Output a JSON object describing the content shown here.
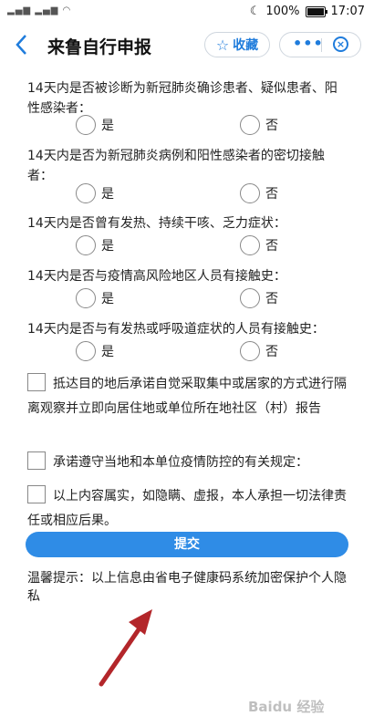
{
  "status_bar": {
    "battery": "100%",
    "time": "17:07"
  },
  "nav": {
    "title": "来鲁自行申报",
    "favorite_label": "收藏"
  },
  "questions": [
    {
      "text": "14天内是否被诊断为新冠肺炎确诊患者、疑似患者、阳性感染者：",
      "yes": "是",
      "no": "否"
    },
    {
      "text": "14天内是否为新冠肺炎病例和阳性感染者的密切接触者：",
      "yes": "是",
      "no": "否"
    },
    {
      "text": "14天内是否曾有发热、持续干咳、乏力症状：",
      "yes": "是",
      "no": "否"
    },
    {
      "text": "14天内是否与疫情高风险地区人员有接触史：",
      "yes": "是",
      "no": "否"
    },
    {
      "text": "14天内是否与有发热或呼吸道症状的人员有接触史：",
      "yes": "是",
      "no": "否"
    }
  ],
  "pledges": [
    {
      "text": "抵达目的地后承诺自觉采取集中或居家的方式进行隔离观察并立即向居住地或单位所在地社区（村）报告"
    },
    {
      "text": "承诺遵守当地和本单位疫情防控的有关规定："
    },
    {
      "text": "以上内容属实，如隐瞒、虚报，本人承担一切法律责任或相应后果。"
    }
  ],
  "submit_label": "提交",
  "tip": "温馨提示：以上信息由省电子健康码系统加密保护个人隐私",
  "watermark": "Baidu 经验"
}
